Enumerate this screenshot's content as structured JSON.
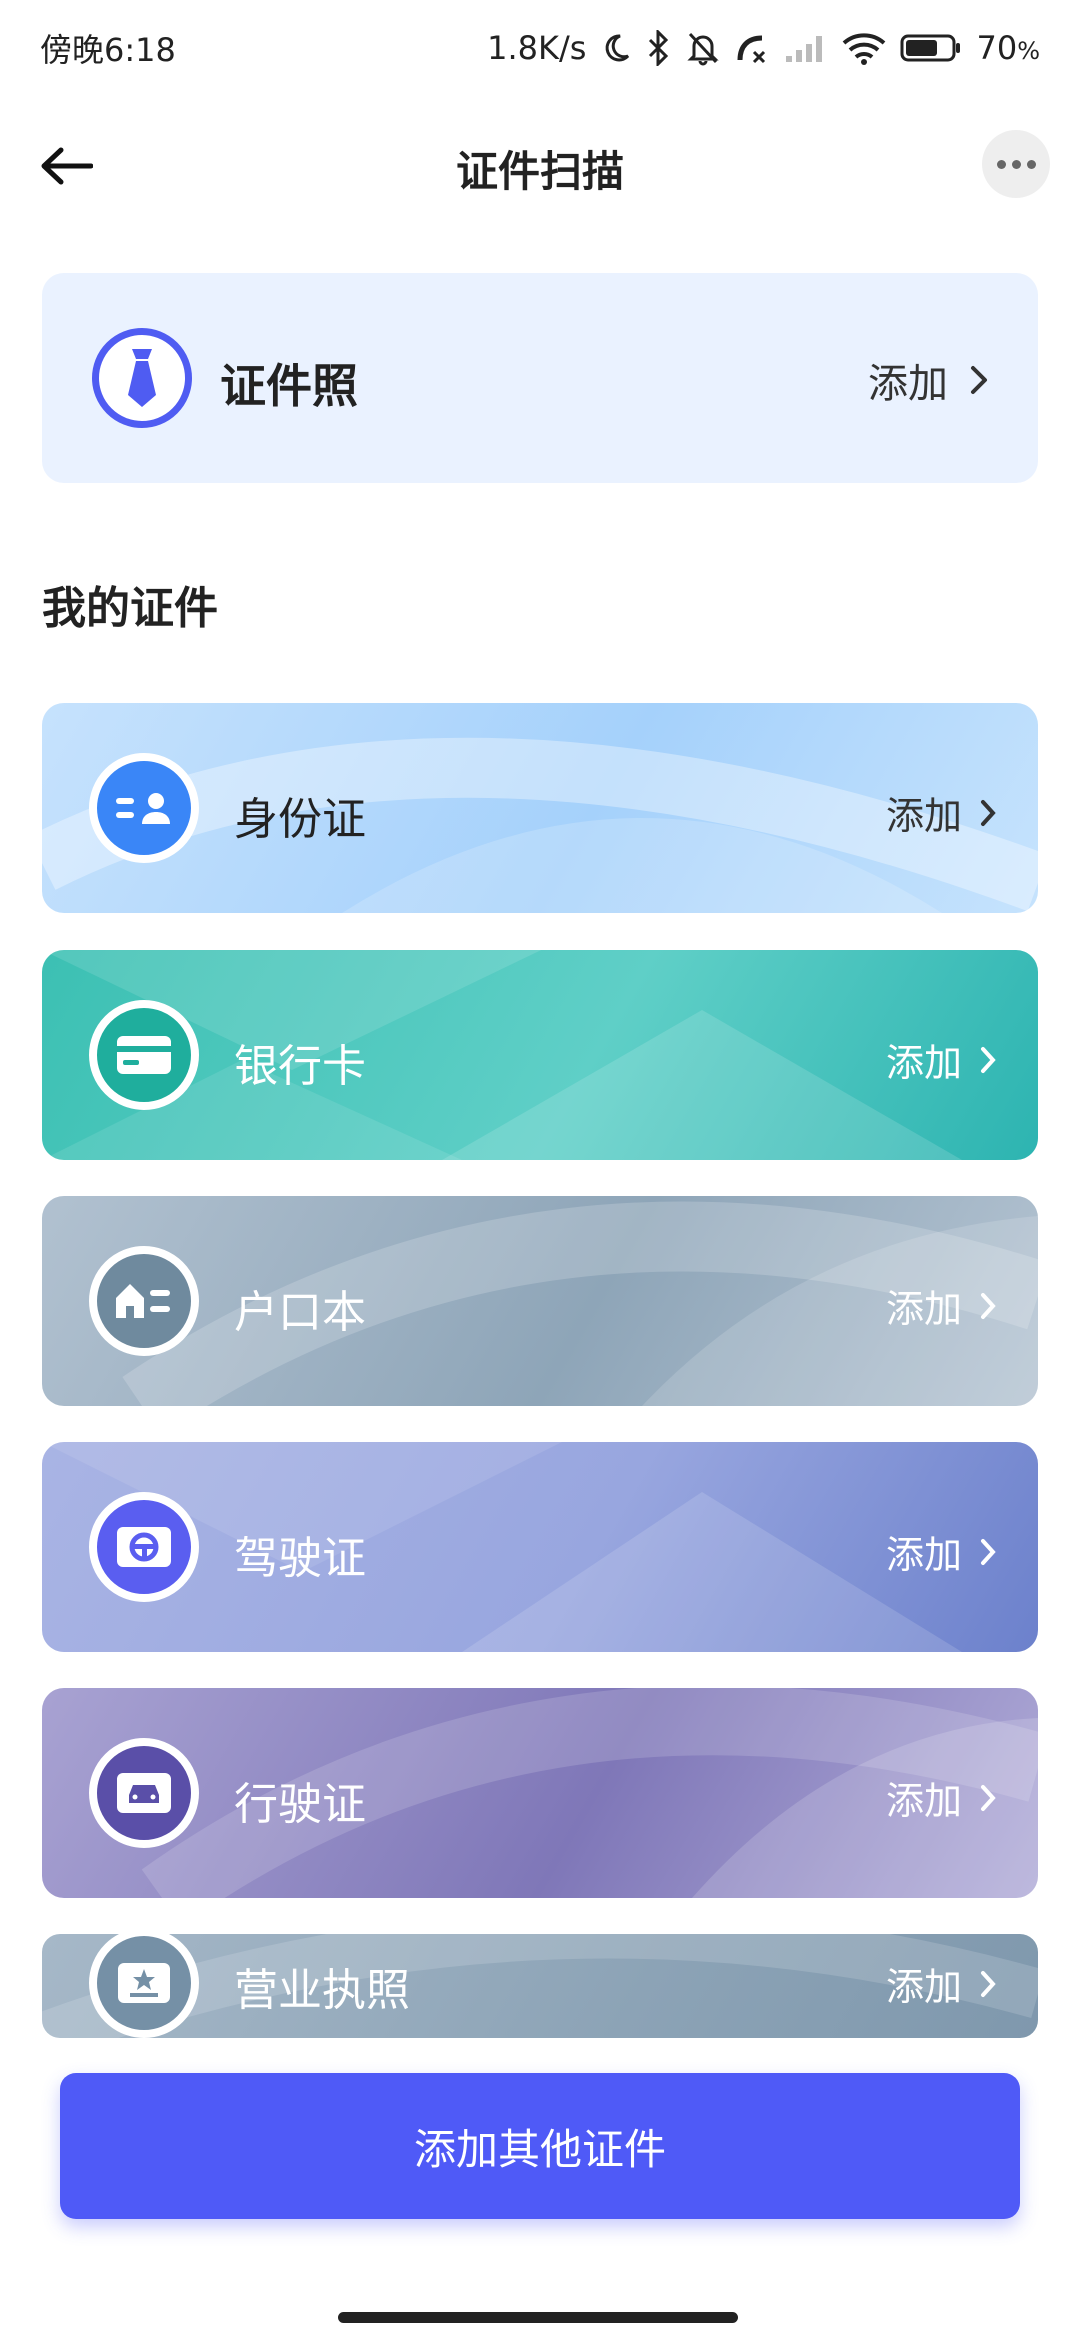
{
  "status": {
    "time": "傍晚6:18",
    "network_speed": "1.8K/s",
    "battery": "70",
    "battery_unit": "%",
    "battery_level": 0.7
  },
  "header": {
    "title": "证件扫描"
  },
  "photo_card": {
    "label": "证件照",
    "action": "添加"
  },
  "section_title": "我的证件",
  "cards": [
    {
      "label": "身份证",
      "action": "添加",
      "icon": "id-card-icon"
    },
    {
      "label": "银行卡",
      "action": "添加",
      "icon": "bank-card-icon"
    },
    {
      "label": "户口本",
      "action": "添加",
      "icon": "household-register-icon"
    },
    {
      "label": "驾驶证",
      "action": "添加",
      "icon": "steering-wheel-icon"
    },
    {
      "label": "行驶证",
      "action": "添加",
      "icon": "car-icon"
    },
    {
      "label": "营业执照",
      "action": "添加",
      "icon": "business-license-icon"
    }
  ],
  "add_other": {
    "label": "添加其他证件"
  },
  "colors": {
    "accent": "#4f5af7",
    "photo_card_bg": "#eaf2ff",
    "id_card": "#bcdcfb",
    "bank_card": "#3fbfb5",
    "household": "#9fb2c4",
    "driver_license": "#95a3dc",
    "vehicle_license": "#9890c8",
    "business_license": "#93a9bb"
  }
}
